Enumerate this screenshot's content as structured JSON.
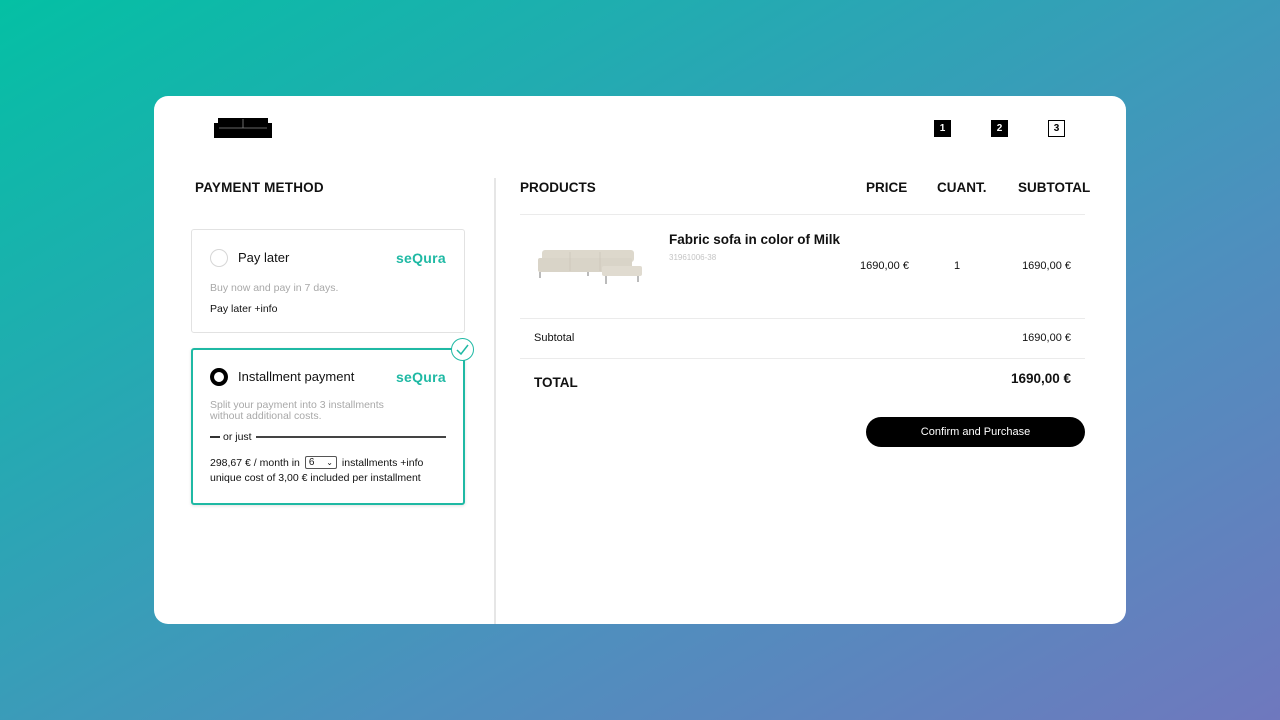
{
  "colors": {
    "accent": "#1fb9a4",
    "background_gradient": [
      "#04c0a4",
      "#6f78be"
    ],
    "button": "#000000"
  },
  "header": {
    "logo_icon": "sofa-icon",
    "steps": [
      {
        "label": "1",
        "state": "done"
      },
      {
        "label": "2",
        "state": "done"
      },
      {
        "label": "3",
        "state": "current"
      }
    ]
  },
  "payment": {
    "title": "PAYMENT METHOD",
    "options": [
      {
        "label": "Pay later",
        "brand": "seQura",
        "selected": false,
        "description": "Buy now and pay in 7 days.",
        "info_link": "Pay later +info"
      },
      {
        "label": "Installment payment",
        "brand": "seQura",
        "selected": true,
        "description": "Split your payment into 3 installments without additional costs.",
        "or_just": "or just",
        "amount_text": "298,67 € / month in",
        "installments_selected": "6",
        "installments_suffix": "installments +info",
        "unique_cost": "unique cost of 3,00 € included per installment"
      }
    ]
  },
  "cart": {
    "columns": {
      "products": "PRODUCTS",
      "price": "PRICE",
      "quantity": "CUANT.",
      "subtotal": "SUBTOTAL"
    },
    "items": [
      {
        "name": "Fabric sofa in color of Milk",
        "sku": "31961006-38",
        "price": "1690,00 €",
        "quantity": "1",
        "subtotal": "1690,00 €"
      }
    ],
    "subtotal_label": "Subtotal",
    "subtotal_value": "1690,00 €",
    "total_label": "TOTAL",
    "total_value": "1690,00 €",
    "confirm_label": "Confirm and Purchase"
  }
}
